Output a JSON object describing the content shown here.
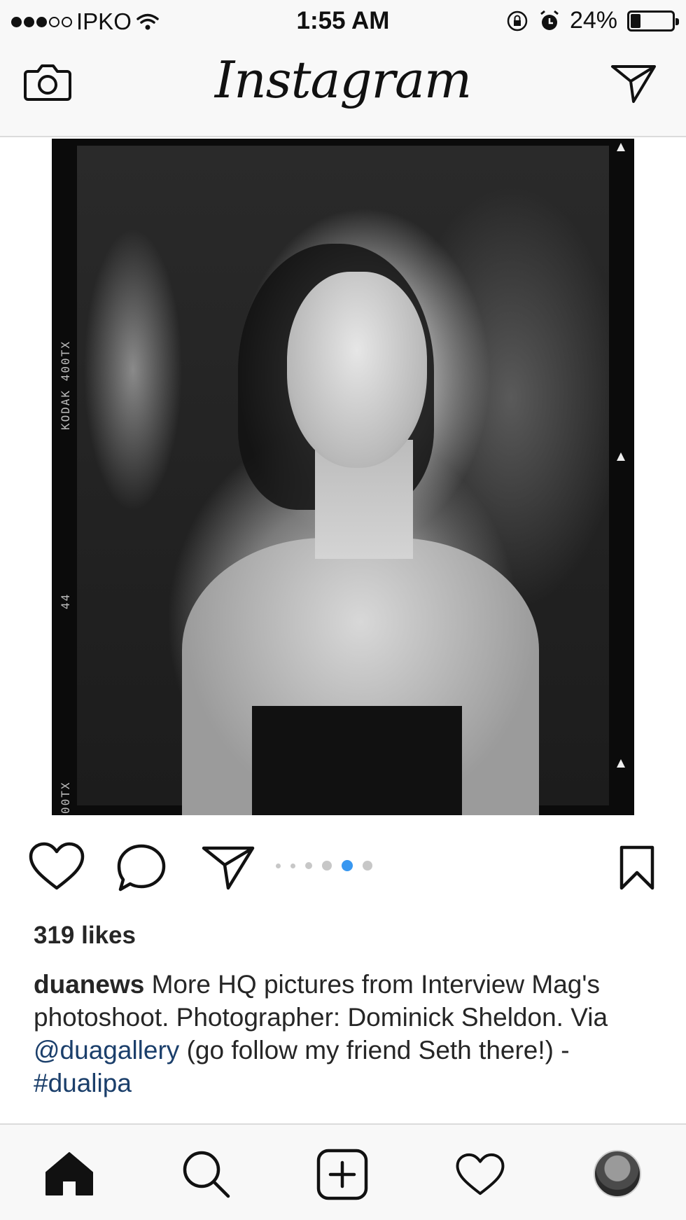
{
  "status_bar": {
    "carrier": "IPKO",
    "time": "1:55 AM",
    "battery": "24%",
    "battery_level": 0.24,
    "signal_bars_filled": 3,
    "signal_bars_total": 5
  },
  "header": {
    "logo": "Instagram",
    "left_icon": "camera-icon",
    "right_icon": "direct-message-icon"
  },
  "post": {
    "photo": {
      "film_brand": "KODAK  400TX",
      "frame_number": "44",
      "film_code_bottom": "00TX"
    },
    "actions": {
      "like_icon": "heart-icon",
      "comment_icon": "comment-bubble-icon",
      "share_icon": "paper-plane-icon",
      "save_icon": "bookmark-icon"
    },
    "carousel": {
      "count": 6,
      "active_index": 4,
      "active_color": "#3897f0"
    },
    "likes": "319 likes",
    "caption": {
      "username": "duanews",
      "text_1": " More HQ pictures from Interview Mag's photoshoot. Photographer: Dominick Sheldon. Via ",
      "mention": "@duagallery",
      "text_2": " (go follow my friend Seth there!) - ",
      "hashtag": "#dualipa"
    }
  },
  "tab_bar": {
    "items": [
      "home-icon",
      "search-icon",
      "add-post-icon",
      "activity-heart-icon",
      "profile-avatar"
    ],
    "active": "home-icon"
  },
  "colors": {
    "link": "#1b3f6b",
    "text": "#262626",
    "divider": "#dbdbdb",
    "bar_background": "#f8f8f8"
  }
}
